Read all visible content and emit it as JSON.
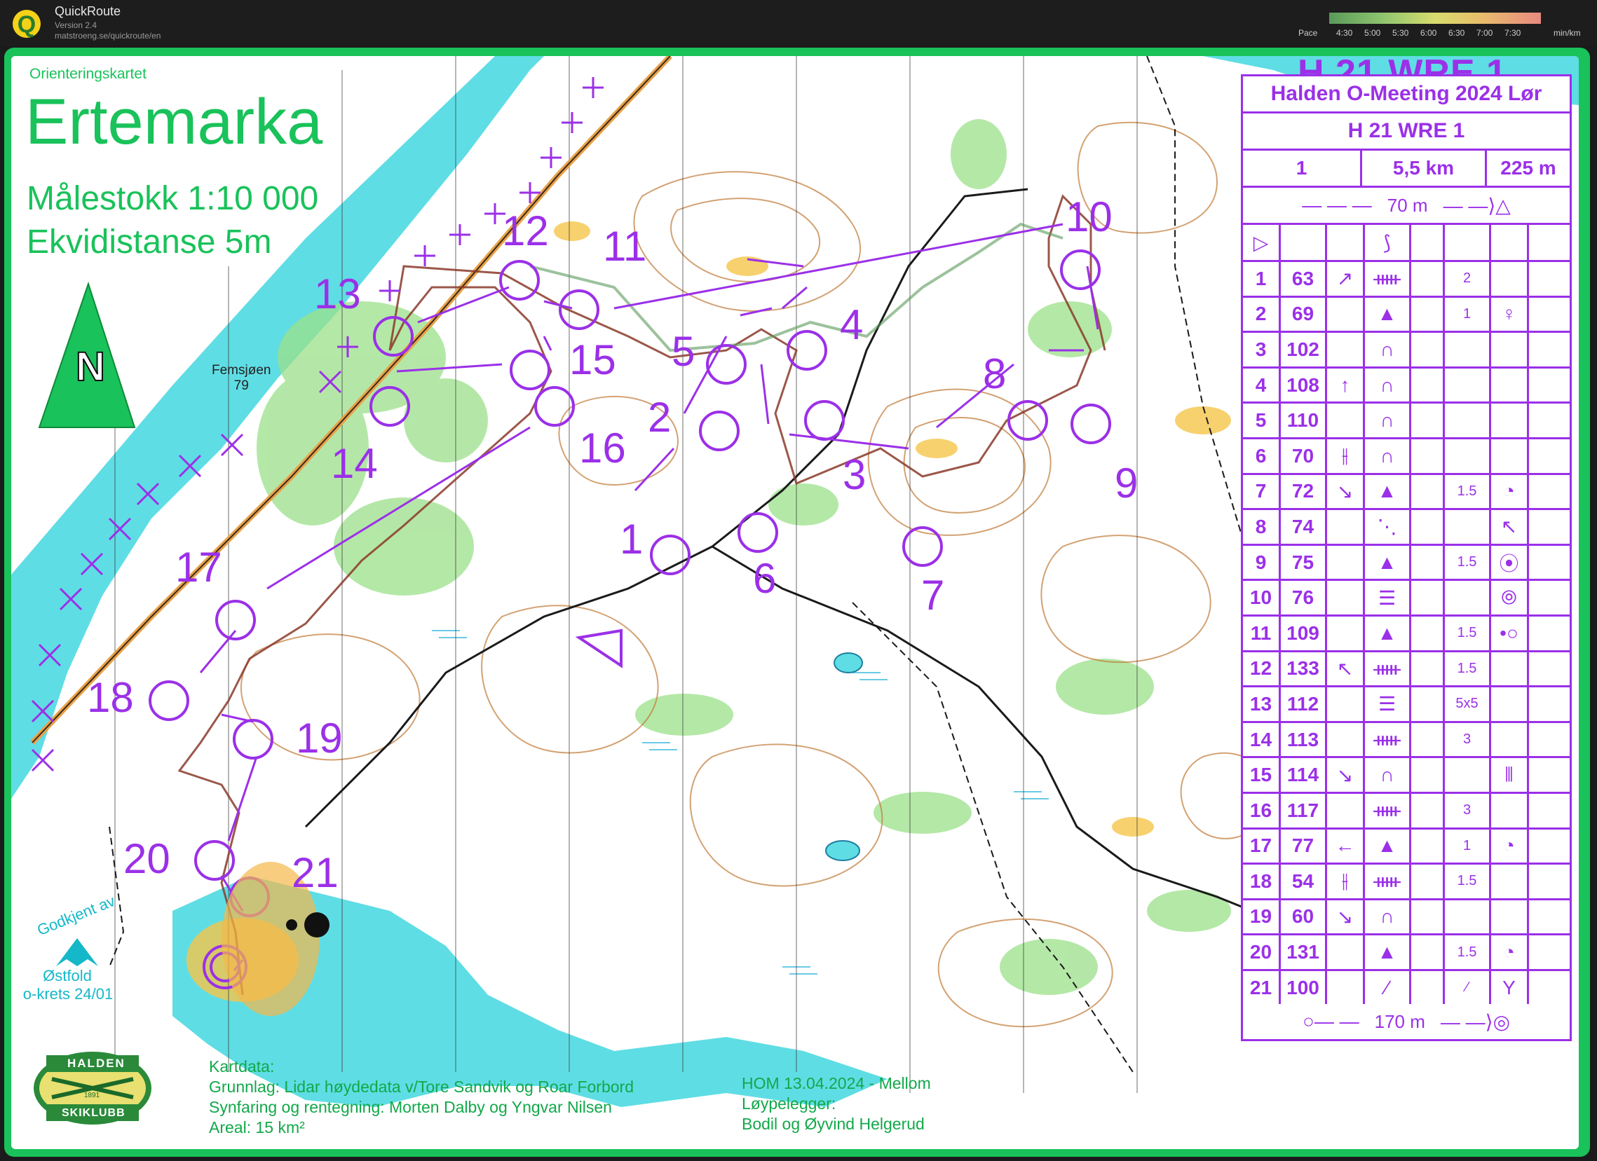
{
  "app": {
    "name": "QuickRoute",
    "version": "Version 2.4",
    "url": "matstroeng.se/quickroute/en"
  },
  "pace_scale": {
    "label": "Pace",
    "unit": "min/km",
    "ticks": [
      "4:30",
      "5:00",
      "5:30",
      "6:00",
      "6:30",
      "7:00",
      "7:30"
    ]
  },
  "map": {
    "club": "Orienteringskartet",
    "name": "Ertemarka",
    "scale": "Målestokk 1:10 000",
    "contour": "Ekvidistanse 5m",
    "north": "N",
    "lake": {
      "name": "Femsjøen",
      "height": "79"
    },
    "course_title": "H 21 WRE 1",
    "approval": {
      "text": "Godkjent av",
      "region": "Østfold",
      "krets": "o-krets 24/01"
    },
    "club_logo": {
      "top": "HALDEN",
      "year": "1891",
      "bottom": "SKIKLUBB"
    },
    "credits": {
      "heading": "Kartdata:",
      "line1": "Grunnlag: Lidar høydedata v/Tore Sandvik og Roar Forbord",
      "line2": "Synfaring og rentegning: Morten Dalby og Yngvar Nilsen",
      "line3": "Areal: 15 km²"
    },
    "event": {
      "line1": "HOM 13.04.2024 - Mellom",
      "line2": "Løypelegger:",
      "line3": "Bodil og Øyvind Helgerud"
    },
    "controls": [
      "1",
      "2",
      "3",
      "4",
      "5",
      "6",
      "7",
      "8",
      "9",
      "10",
      "11",
      "12",
      "13",
      "14",
      "15",
      "16",
      "17",
      "18",
      "19",
      "20",
      "21"
    ]
  },
  "description": {
    "event": "Halden O-Meeting 2024 Lør",
    "class": "H 21 WRE 1",
    "course_no": "1",
    "length": "5,5 km",
    "climb": "225 m",
    "start_marked": "70 m",
    "finish_marked": "170 m",
    "rows": [
      {
        "n": "1",
        "code": "63",
        "dir": "↗",
        "feat": "ᚔ",
        "dim": "2",
        "extra": ""
      },
      {
        "n": "2",
        "code": "69",
        "dir": "",
        "feat": "▲",
        "dim": "1",
        "extra": "♀"
      },
      {
        "n": "3",
        "code": "102",
        "dir": "",
        "feat": "∩",
        "dim": "",
        "extra": ""
      },
      {
        "n": "4",
        "code": "108",
        "dir": "↑",
        "feat": "∩",
        "dim": "",
        "extra": ""
      },
      {
        "n": "5",
        "code": "110",
        "dir": "",
        "feat": "∩",
        "dim": "",
        "extra": ""
      },
      {
        "n": "6",
        "code": "70",
        "dir": "⫲",
        "feat": "∩",
        "dim": "",
        "extra": ""
      },
      {
        "n": "7",
        "code": "72",
        "dir": "↘",
        "feat": "▲",
        "dim": "1.5",
        "extra": "◔"
      },
      {
        "n": "8",
        "code": "74",
        "dir": "",
        "feat": "⋱",
        "dim": "",
        "extra": "↖"
      },
      {
        "n": "9",
        "code": "75",
        "dir": "",
        "feat": "▲",
        "dim": "1.5",
        "extra": "⦿"
      },
      {
        "n": "10",
        "code": "76",
        "dir": "",
        "feat": "☰",
        "dim": "",
        "extra": "⦾"
      },
      {
        "n": "11",
        "code": "109",
        "dir": "",
        "feat": "▲",
        "dim": "1.5",
        "extra": "•○"
      },
      {
        "n": "12",
        "code": "133",
        "dir": "↖",
        "feat": "ᚔ",
        "dim": "1.5",
        "extra": ""
      },
      {
        "n": "13",
        "code": "112",
        "dir": "",
        "feat": "☰",
        "dim": "5x5",
        "extra": ""
      },
      {
        "n": "14",
        "code": "113",
        "dir": "",
        "feat": "ᚔ",
        "dim": "3",
        "extra": ""
      },
      {
        "n": "15",
        "code": "114",
        "dir": "↘",
        "feat": "∩",
        "dim": "",
        "extra": "⫴"
      },
      {
        "n": "16",
        "code": "117",
        "dir": "",
        "feat": "ᚔ",
        "dim": "3",
        "extra": ""
      },
      {
        "n": "17",
        "code": "77",
        "dir": "←",
        "feat": "▲",
        "dim": "1",
        "extra": "◔"
      },
      {
        "n": "18",
        "code": "54",
        "dir": "⫲",
        "feat": "ᚔ",
        "dim": "1.5",
        "extra": ""
      },
      {
        "n": "19",
        "code": "60",
        "dir": "↘",
        "feat": "∩",
        "dim": "",
        "extra": ""
      },
      {
        "n": "20",
        "code": "131",
        "dir": "",
        "feat": "▲",
        "dim": "1.5",
        "extra": "◔"
      },
      {
        "n": "21",
        "code": "100",
        "dir": "",
        "feat": "∕",
        "dim": "∕",
        "extra": "Y"
      }
    ]
  },
  "colors": {
    "course": "#9b30e8",
    "frame": "#19c25a",
    "water": "#5fdde4",
    "contour": "#b8661e",
    "forest_open": "#ffffff",
    "green": "#9be08a",
    "track": "#8a3a2a"
  }
}
